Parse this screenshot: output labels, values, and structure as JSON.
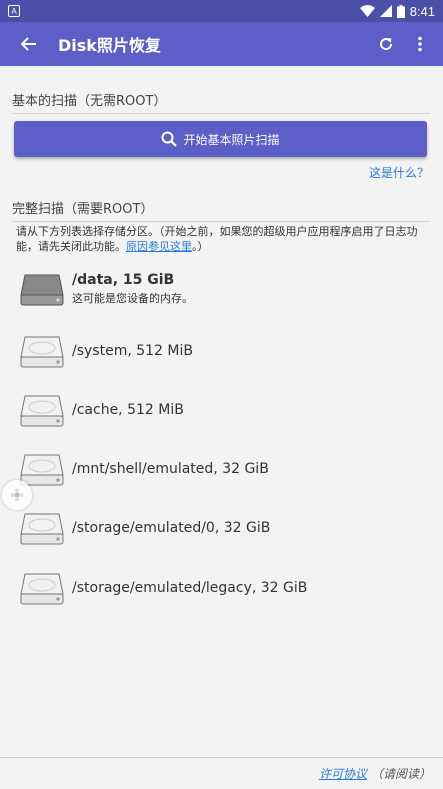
{
  "status_bar": {
    "time": "8:41"
  },
  "app_bar": {
    "title": "Disk照片恢复"
  },
  "basic_scan": {
    "header": "基本的扫描（无需ROOT）",
    "button_label": "开始基本照片扫描",
    "what_is_link": "这是什么？"
  },
  "full_scan": {
    "header": "完整扫描（需要ROOT）",
    "note_text": "请从下方列表选择存储分区。（开始之前，如果您的超级用户应用程序启用了日志功能，请先关闭此功能。",
    "note_link": "原因参见这里",
    "note_end": "。）"
  },
  "partitions": [
    {
      "label": "/data, 15 GiB",
      "sublabel": "这可能是您设备的内存。",
      "primary": true
    },
    {
      "label": "/system, 512 MiB"
    },
    {
      "label": "/cache, 512 MiB"
    },
    {
      "label": "/mnt/shell/emulated, 32 GiB"
    },
    {
      "label": "/storage/emulated/0, 32 GiB"
    },
    {
      "label": "/storage/emulated/legacy, 32 GiB"
    }
  ],
  "footer": {
    "license_link": "许可协议",
    "read_hint": "（请阅读）"
  },
  "colors": {
    "accent": "#5b5fc7",
    "status_bar": "#4a4fa8",
    "link": "#2a7ad8"
  }
}
